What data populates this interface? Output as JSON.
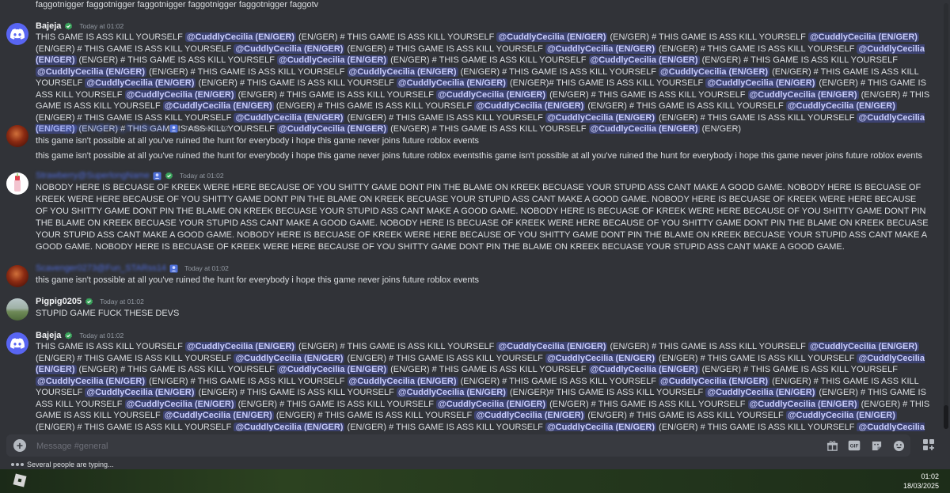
{
  "top_line": "faggotnigger faggotnigger faggotnigger faggotnigger faggotnigger faggotv",
  "messages": {
    "m1": {
      "author": "Bajeja",
      "timestamp": "Today at 01:02",
      "bits": {
        "t0": "THIS GAME IS ASS KILL YOURSELF ",
        "m1": "@CuddlyCecilia (EN/GER)",
        "t1": " (EN/GER) # THIS GAME IS ASS KILL YOURSELF ",
        "m2": "@CuddlyCecilia (EN/GER)",
        "t2": " (EN/GER) # THIS GAME IS ASS KILL YOURSELF ",
        "m3": "@CuddlyCecilia (EN/GER)",
        "t3": " (EN/GER) # THIS GAME IS ASS KILL YOURSELF ",
        "m4": "@CuddlyCecilia (EN/GER)",
        "t4": " (EN/GER) # THIS GAME IS ASS KILL YOURSELF ",
        "m5": "@CuddlyCecilia (EN/GER)",
        "t5": " (EN/GER) # THIS GAME IS ASS KILL YOURSELF ",
        "m6": "@CuddlyCecilia (EN/GER)",
        "t6": " (EN/GER) # THIS GAME IS ASS KILL YOURSELF ",
        "m7": "@CuddlyCecilia (EN/GER)",
        "t7": " (EN/GER) # THIS GAME IS ASS KILL YOURSELF ",
        "m8": "@CuddlyCecilia (EN/GER)",
        "t8": " (EN/GER) # THIS GAME IS ASS KILL YOURSELF ",
        "m9": "@CuddlyCecilia (EN/GER)",
        "t9": " (EN/GER) # THIS GAME IS ASS KILL YOURSELF ",
        "m10": "@CuddlyCecilia (EN/GER)",
        "t10": " (EN/GER) # THIS GAME IS ASS KILL YOURSELF ",
        "m11": "@CuddlyCecilia (EN/GER)",
        "t11": " (EN/GER) # THIS GAME IS ASS KILL YOURSELF ",
        "m12": "@CuddlyCecilia (EN/GER)",
        "t12": " (EN/GER) # THIS GAME IS ASS KILL YOURSELF ",
        "m13": "@CuddlyCecilia (EN/GER)",
        "t13": " (EN/GER)# THIS GAME IS ASS KILL YOURSELF ",
        "m14": "@CuddlyCecilia (EN/GER)",
        "t14": " (EN/GER) # THIS GAME IS ASS KILL YOURSELF ",
        "m15": "@CuddlyCecilia (EN/GER)",
        "t15": " (EN/GER) # THIS GAME IS ASS KILL YOURSELF ",
        "m16": "@CuddlyCecilia (EN/GER)",
        "t16": " (EN/GER) # THIS GAME IS ASS KILL YOURSELF ",
        "m17": "@CuddlyCecilia (EN/GER)",
        "t17": " (EN/GER) # THIS GAME IS ASS KILL YOURSELF ",
        "m18": "@CuddlyCecilia (EN/GER)",
        "t18": " (EN/GER) # THIS GAME IS ASS KILL YOURSELF ",
        "m19": "@CuddlyCecilia (EN/GER)",
        "t19": " (EN/GER) # THIS GAME IS ASS KILL YOURSELF ",
        "m20": "@CuddlyCecilia (EN/GER)",
        "t20": " (EN/GER) # THIS GAME IS ASS KILL YOURSELF ",
        "m21": "@CuddlyCecilia (EN/GER)",
        "t21": " (EN/GER) # THIS GAME IS ASS KILL YOURSELF ",
        "m22": "@CuddlyCecilia (EN/GER)",
        "t22": " (EN/GER) # THIS GAME IS ASS KILL YOURSELF ",
        "m23": "@CuddlyCecilia (EN/GER)",
        "t23": " (EN/GER) # THIS GAME IS ASS KILL YOURSELF ",
        "m24": "@CuddlyCecilia (EN/GER)",
        "t24": " (EN/GER) # THIS GAME IS ASS KILL YOURSELF ",
        "m25": "@CuddlyCecilia (EN/GER)",
        "t25": " (EN/GER)"
      }
    },
    "m2": {
      "author": "Scavenger0273@Fun_STARss14",
      "timestamp": "Today at 01:02",
      "line1": "this game isn't possible at all you've ruined the hunt for everybody i hope this game never joins future roblox events",
      "line2": "this game isn't possible at all you've ruined the hunt for everybody i hope this game never joins future roblox eventsthis game isn't possible at all you've ruined the hunt for everybody i hope this game never joins future roblox events"
    },
    "m3": {
      "author": "Strawberry@SuperlongName",
      "timestamp": "Today at 01:02",
      "text": "NOBODY HERE IS BECUASE OF KREEK WERE HERE BECAUSE OF YOU SHITTY GAME DONT PIN THE BLAME ON KREEK BECUASE YOUR STUPID ASS CANT MAKE A GOOD GAME. NOBODY HERE IS BECUASE OF KREEK WERE HERE BECAUSE OF YOU SHITTY GAME DONT PIN THE BLAME ON KREEK BECUASE YOUR STUPID ASS CANT MAKE A GOOD GAME. NOBODY HERE IS BECUASE OF KREEK WERE HERE BECAUSE OF YOU SHITTY GAME DONT PIN THE BLAME ON KREEK BECUASE YOUR STUPID ASS CANT MAKE A GOOD GAME. NOBODY HERE IS BECUASE OF KREEK WERE HERE BECAUSE OF YOU SHITTY GAME DONT PIN THE BLAME ON KREEK BECUASE YOUR STUPID ASS CANT MAKE A GOOD GAME. NOBODY HERE IS BECUASE OF KREEK WERE HERE BECAUSE OF YOU SHITTY GAME DONT PIN THE BLAME ON KREEK BECUASE YOUR STUPID ASS CANT MAKE A GOOD GAME. NOBODY HERE IS BECUASE OF KREEK WERE HERE BECAUSE OF YOU SHITTY GAME DONT PIN THE BLAME ON KREEK BECUASE YOUR STUPID ASS CANT MAKE A GOOD GAME. NOBODY HERE IS BECUASE OF KREEK WERE HERE BECAUSE OF YOU SHITTY GAME DONT PIN THE BLAME ON KREEK BECUASE YOUR STUPID ASS CANT MAKE A GOOD GAME."
    },
    "m4": {
      "author": "Scavenger0273@Fun_STARss14",
      "timestamp": "Today at 01:02",
      "text": "this game isn't possible at all you've ruined the hunt for everybody i hope this game never joins future roblox events"
    },
    "m5": {
      "author": "Pigpig0205",
      "timestamp": "Today at 01:02",
      "text": "STUPID GAME FUCK THESE DEVS"
    },
    "m6": {
      "author": "Bajeja",
      "timestamp": "Today at 01:02"
    }
  },
  "composer": {
    "placeholder": "Message #general"
  },
  "typing": "Several people are typing...",
  "clock": {
    "time": "01:02",
    "date": "18/03/2025"
  },
  "colors": {
    "background": "#313338",
    "mention_bg": "#3c4270",
    "mention_text": "#c9cdfb",
    "blurple": "#5865f2"
  }
}
